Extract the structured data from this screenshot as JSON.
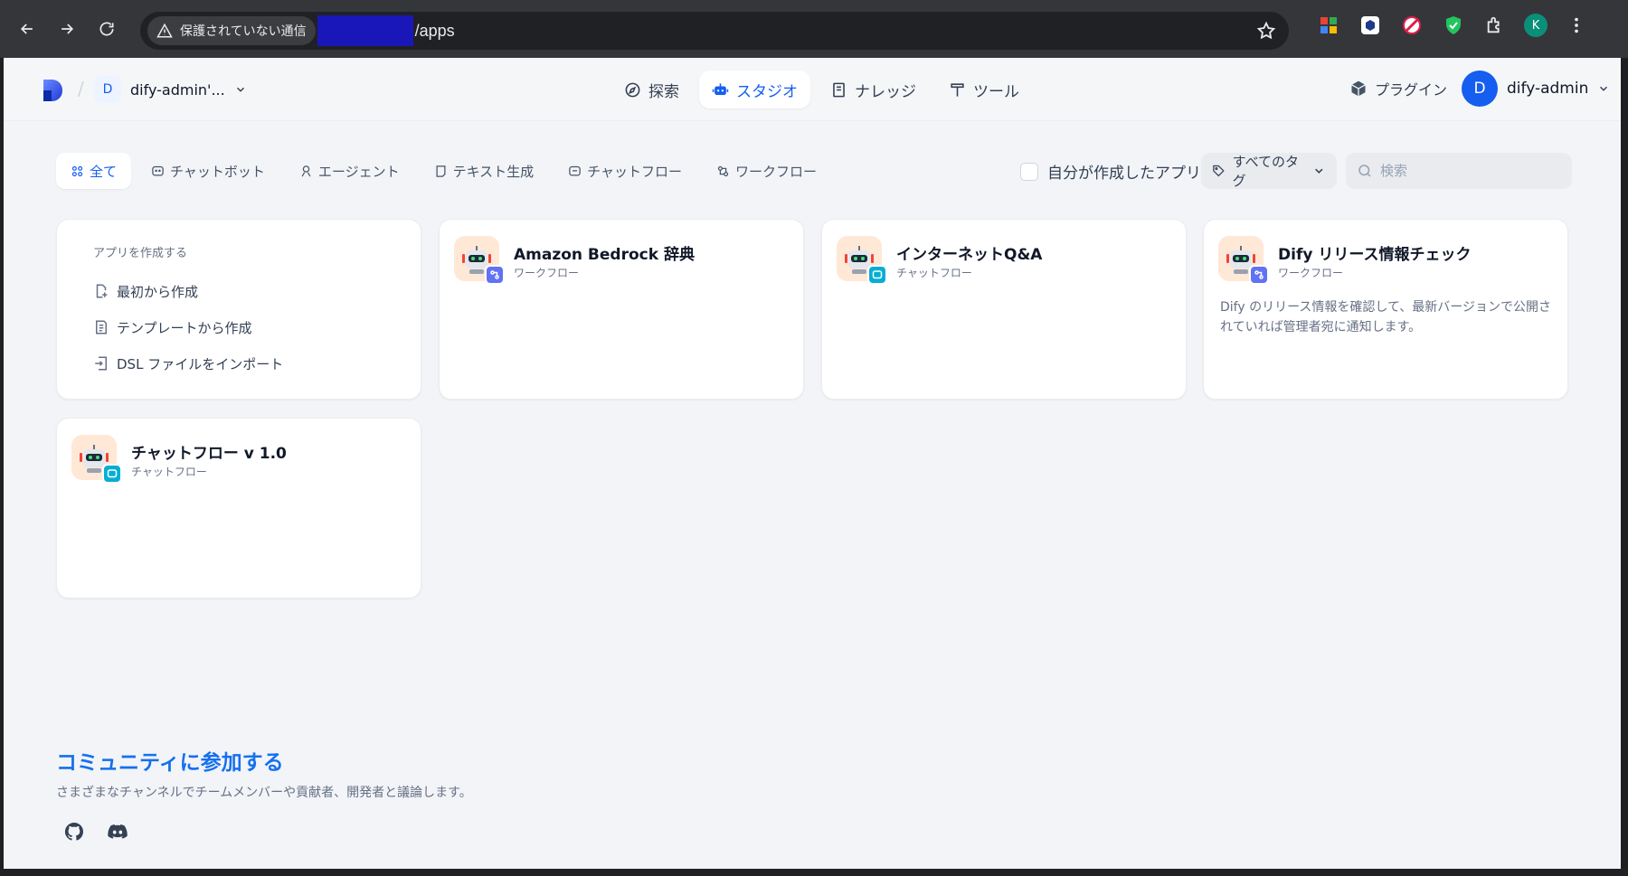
{
  "browser": {
    "security_label": "保護されていない通信",
    "url_path": "/apps",
    "profile_initial": "K"
  },
  "header": {
    "workspace_initial": "D",
    "workspace_name": "dify-admin'...",
    "nav": {
      "explore": "探索",
      "studio": "スタジオ",
      "knowledge": "ナレッジ",
      "tools": "ツール"
    },
    "plugins": "プラグイン",
    "user_initial": "D",
    "user_name": "dify-admin"
  },
  "filters": {
    "tabs": {
      "all": "全て",
      "chatbot": "チャットボット",
      "agent": "エージェント",
      "text_generation": "テキスト生成",
      "chatflow": "チャットフロー",
      "workflow": "ワークフロー"
    },
    "mine_label": "自分が作成したアプリ",
    "tag_label": "すべてのタグ",
    "search_placeholder": "検索"
  },
  "create": {
    "title": "アプリを作成する",
    "blank": "最初から作成",
    "template": "テンプレートから作成",
    "import_dsl": "DSL ファイルをインポート"
  },
  "apps": [
    {
      "name": "Amazon Bedrock 辞典",
      "type": "ワークフロー",
      "description": ""
    },
    {
      "name": "インターネットQ&A",
      "type": "チャットフロー",
      "description": ""
    },
    {
      "name": "Dify リリース情報チェック",
      "type": "ワークフロー",
      "description": "Dify のリリース情報を確認して、最新バージョンで公開されていれば管理者宛に通知します。"
    },
    {
      "name": "チャットフロー v 1.0",
      "type": "チャットフロー",
      "description": ""
    }
  ],
  "community": {
    "title": "コミュニティに参加する",
    "subtitle": "さまざまなチャンネルでチームメンバーや貢献者、開発者と議論します。"
  }
}
